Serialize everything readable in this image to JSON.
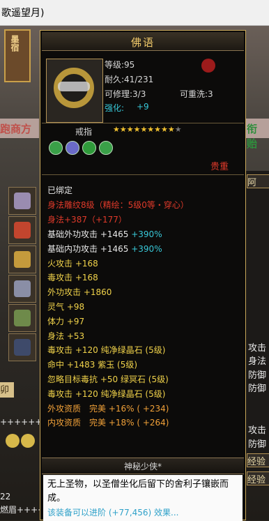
{
  "window": {
    "title": "歌遥望月)"
  },
  "scene": {
    "banner": "墨宿",
    "left_strip": "跑商方",
    "right_strip": "衔 贻",
    "right_panel": [
      "阿",
      "攻击",
      "身法",
      "防御",
      "防御",
      "攻击",
      "防御",
      "经验",
      "经验"
    ],
    "left_label": "卯",
    "left_lines": [
      "++++++++++",
      "22",
      "燃眉++++"
    ]
  },
  "tooltip": {
    "title": "佛语",
    "stats": {
      "level": "等级:95",
      "durability": "耐久:41/231",
      "repairable": "可修理:3/3",
      "rewash": "可重洗:3",
      "strengthen_label": "强化:",
      "strengthen_value": "+9"
    },
    "item_type": "戒指",
    "star_full": "★★★★★★★★★",
    "star_empty": "★",
    "bind_type": "贵重",
    "bound": "已绑定",
    "carve": "身法雕纹8级（精绘：5级0等・穿心）",
    "carve_bonus": "身法+387（+177）",
    "lines": [
      {
        "text": "基础外功攻击 +1465 ",
        "extra": "+390%",
        "color": "#e8e8e8",
        "extra_color": "#38c8d8"
      },
      {
        "text": "基础内功攻击 +1465 ",
        "extra": "+390%",
        "color": "#e8e8e8",
        "extra_color": "#38c8d8"
      },
      {
        "text": "火攻击 +168",
        "extra": "",
        "color": "#f0d24a"
      },
      {
        "text": "毒攻击 +168",
        "extra": "",
        "color": "#f0d24a"
      },
      {
        "text": "外功攻击 +1860",
        "extra": "",
        "color": "#f0d24a"
      },
      {
        "text": "灵气 +98",
        "extra": "",
        "color": "#f0d24a"
      },
      {
        "text": "体力 +97",
        "extra": "",
        "color": "#f0d24a"
      },
      {
        "text": "身法 +53",
        "extra": "",
        "color": "#f0d24a"
      },
      {
        "text": "毒攻击 +120 纯净绿晶石 (5级)",
        "extra": "",
        "color": "#f0d24a"
      },
      {
        "text": "命中 +1483 紫玉 (5级)",
        "extra": "",
        "color": "#f0d24a"
      },
      {
        "text": "忽略目标毒抗 +50 绿冥石 (5级)",
        "extra": "",
        "color": "#f0d24a"
      },
      {
        "text": "毒攻击 +120 纯净绿晶石 (5级)",
        "extra": "",
        "color": "#f0d24a"
      },
      {
        "text": "外攻资质　完美 +16% ( +234)",
        "extra": "",
        "color": "#f0a038"
      },
      {
        "text": "内攻资质　完美 +18% ( +264)",
        "extra": "",
        "color": "#f0a038"
      }
    ],
    "footer": "神秘少侠*",
    "description": "无上圣物，以圣僧坐化后留下的舍利子镶嵌而成。",
    "description_cut": "该装备可以进阶 (+77,456) 效果..."
  },
  "colors": {
    "gold": "#c9a85a",
    "red": "#e03a2a",
    "yellow": "#f0d24a",
    "cyan": "#38c8d8"
  }
}
